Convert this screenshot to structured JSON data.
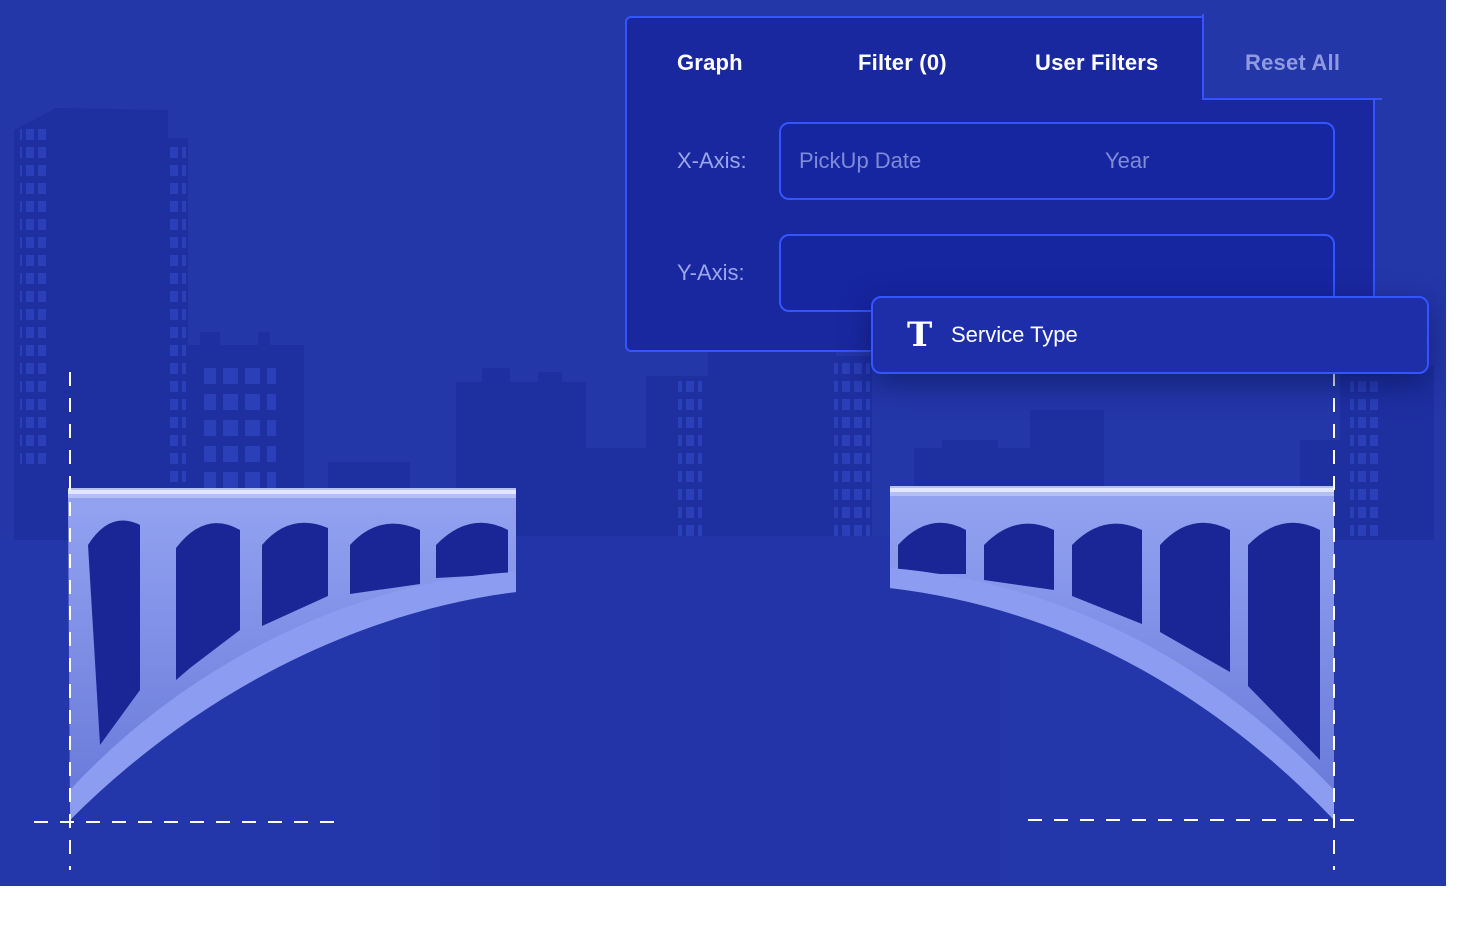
{
  "tabs": {
    "graph": "Graph",
    "filter": "Filter (0)",
    "user_filters": "User Filters",
    "reset_all": "Reset All"
  },
  "fields": {
    "x_axis_label": "X-Axis:",
    "y_axis_label": "Y-Axis:",
    "x_axis_chips": [
      "PickUp Date",
      "Year"
    ]
  },
  "drag_item": {
    "icon": "text-type-icon",
    "glyph": "T",
    "label": "Service Type"
  },
  "colors": {
    "background": "#2437a9",
    "panel": "#1a28a0",
    "border": "#3354ff",
    "bridge": "#7e8fe8"
  }
}
